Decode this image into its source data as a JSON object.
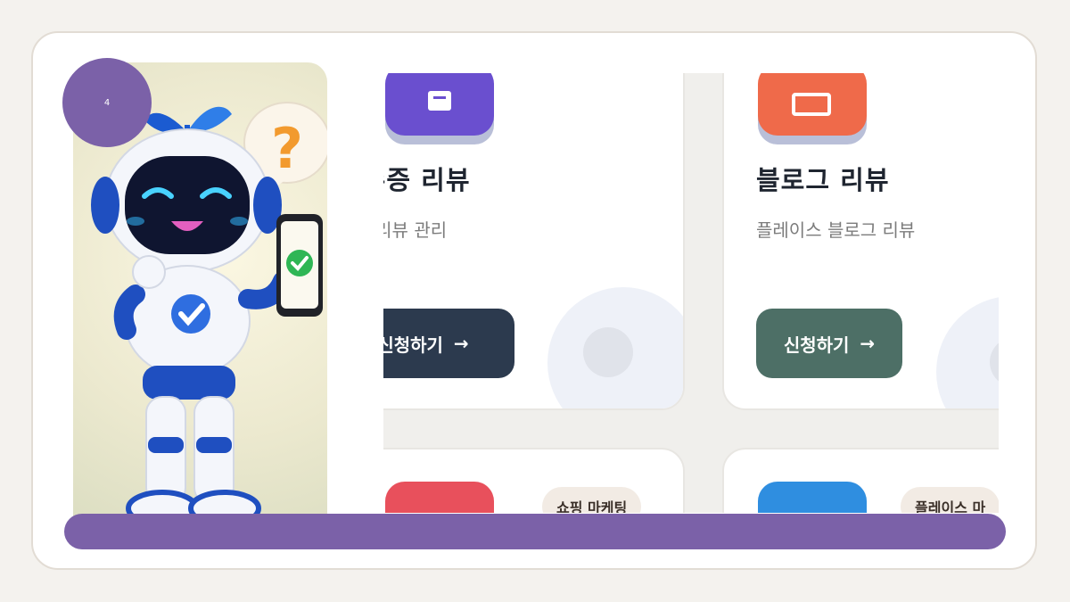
{
  "slide": {
    "page_number": "4"
  },
  "colors": {
    "accent": "#7b61a8",
    "button_dark": "#2c3a4e",
    "button_green": "#4d6f66",
    "icon_purple": "#6a4fcf",
    "icon_orange": "#ef6a4a",
    "icon_red": "#e8505c",
    "icon_blue": "#2f8ee0"
  },
  "robot_image": {
    "icon": "robot-with-phone-illustration"
  },
  "cards": [
    {
      "title": "영수증 리뷰",
      "subtitle": "주문 리뷰 관리",
      "button_label": "신청하기",
      "arrow": "→",
      "icon": "receipt-icon"
    },
    {
      "title": "블로그 리뷰",
      "subtitle": "플레이스 블로그 리뷰",
      "button_label": "신청하기",
      "arrow": "→",
      "icon": "edit-icon"
    },
    {
      "tag": "쇼핑 마케팅",
      "icon": "shopping-icon"
    },
    {
      "tag": "플레이스 마",
      "icon": "place-icon"
    }
  ]
}
